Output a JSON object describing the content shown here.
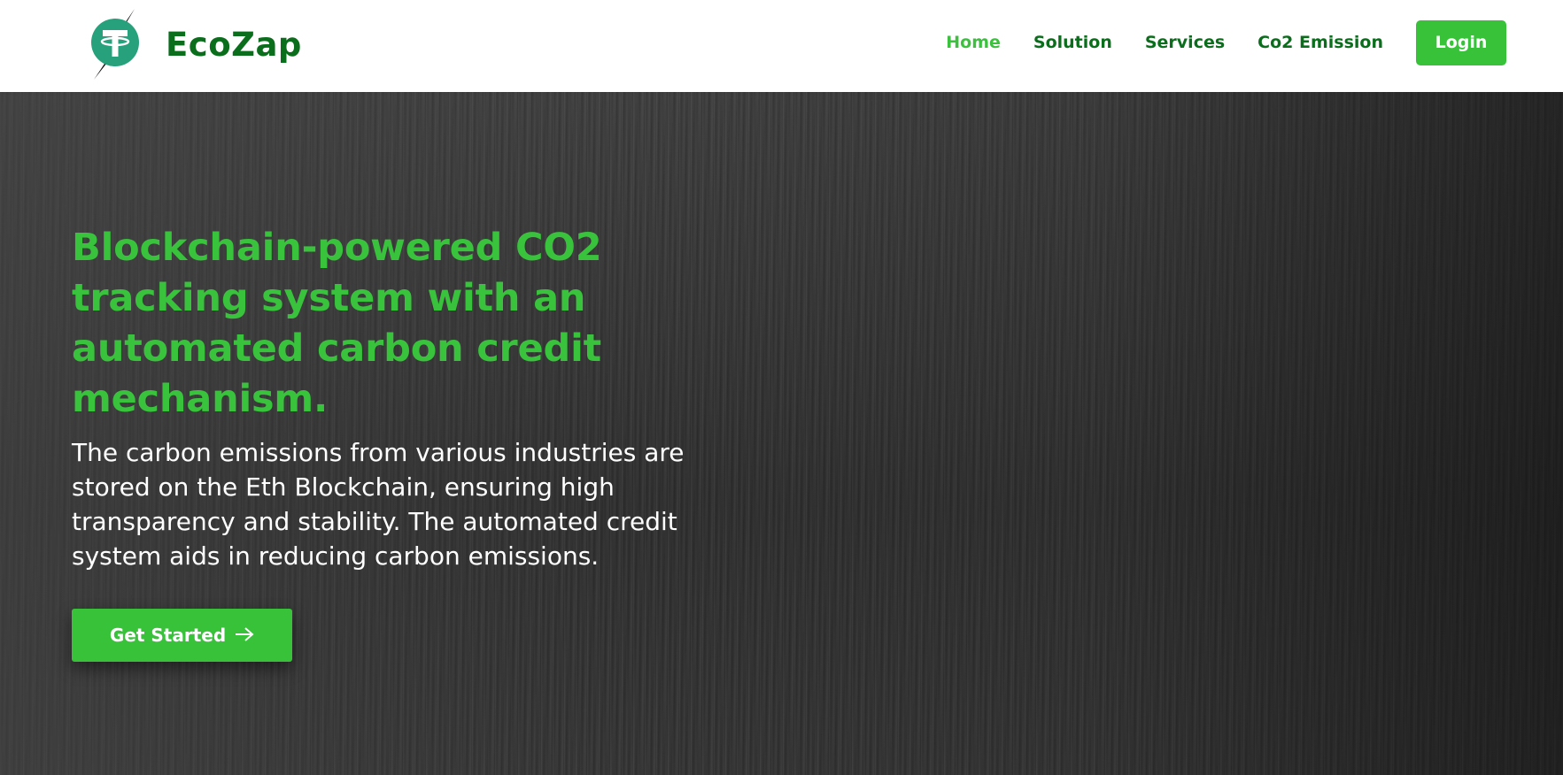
{
  "header": {
    "brand_name": "EcoZap",
    "logo_icon": "tether-lightning-logo",
    "nav": [
      {
        "label": "Home",
        "active": true
      },
      {
        "label": "Solution",
        "active": false
      },
      {
        "label": "Services",
        "active": false
      },
      {
        "label": "Co2 Emission",
        "active": false
      }
    ],
    "login_label": "Login"
  },
  "hero": {
    "title": "Blockchain-powered CO2 tracking system with an automated carbon credit mechanism.",
    "description": "The carbon emissions from various industries are stored on the Eth Blockchain, ensuring high transparency and stability. The automated credit system aids in reducing carbon emissions.",
    "cta_label": "Get Started",
    "cta_icon": "arrow-right-icon"
  },
  "colors": {
    "brand_dark_green": "#0b6e1c",
    "accent_green": "#37c23a",
    "hero_bg": "#2f2f2f",
    "text_white": "#ffffff"
  }
}
